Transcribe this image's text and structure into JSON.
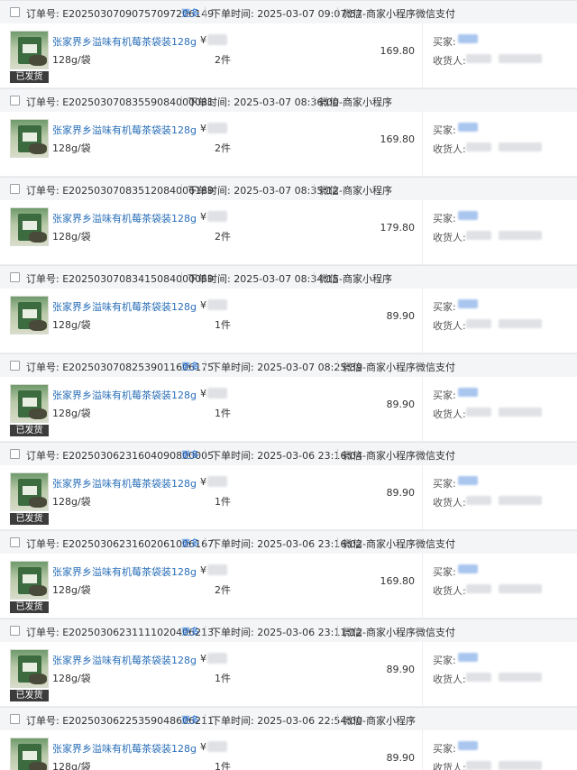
{
  "labels": {
    "order_no": "订单号:",
    "order_time": "下单时间:",
    "buyer": "买家:",
    "receiver": "收货人:",
    "more": "更多",
    "shipped": "已发货",
    "price_symbol": "¥"
  },
  "product": {
    "name": "张家界乡溢味有机莓茶袋装128g",
    "spec": "128g/袋"
  },
  "orders": [
    {
      "id": "E20250307090757097206149",
      "time": "2025-03-07 09:07:57",
      "channel": "微信-商家小程序",
      "payment": "微信支付",
      "has_more": true,
      "shipped": true,
      "qty": "2件",
      "total": "169.80"
    },
    {
      "id": "E20250307083559084000031",
      "time": "2025-03-07 08:36:00",
      "channel": "微信-商家小程序",
      "payment": "",
      "has_more": false,
      "shipped": false,
      "qty": "2件",
      "total": "169.80"
    },
    {
      "id": "E20250307083512084006189",
      "time": "2025-03-07 08:35:12",
      "channel": "微信-商家小程序",
      "payment": "",
      "has_more": false,
      "shipped": false,
      "qty": "2件",
      "total": "179.80"
    },
    {
      "id": "E20250307083415084000059",
      "time": "2025-03-07 08:34:15",
      "channel": "微信-商家小程序",
      "payment": "",
      "has_more": false,
      "shipped": false,
      "qty": "1件",
      "total": "89.90"
    },
    {
      "id": "E20250307082539011606175",
      "time": "2025-03-07 08:25:39",
      "channel": "微信-商家小程序",
      "payment": "微信支付",
      "has_more": true,
      "shipped": true,
      "qty": "1件",
      "total": "89.90"
    },
    {
      "id": "E20250306231604090800005",
      "time": "2025-03-06 23:16:04",
      "channel": "微信-商家小程序",
      "payment": "微信支付",
      "has_more": true,
      "shipped": true,
      "qty": "1件",
      "total": "89.90"
    },
    {
      "id": "E20250306231602061006167",
      "time": "2025-03-06 23:16:02",
      "channel": "微信-商家小程序",
      "payment": "微信支付",
      "has_more": true,
      "shipped": true,
      "qty": "2件",
      "total": "169.80"
    },
    {
      "id": "E20250306231111020406213",
      "time": "2025-03-06 23:11:12",
      "channel": "微信-商家小程序",
      "payment": "微信支付",
      "has_more": true,
      "shipped": true,
      "qty": "1件",
      "total": "89.90"
    },
    {
      "id": "E20250306225359048606211",
      "time": "2025-03-06 22:54:00",
      "channel": "微信-商家小程序",
      "payment": "",
      "has_more": true,
      "shipped": true,
      "qty": "1件",
      "total": "89.90"
    }
  ],
  "colors": {
    "link": "#2a6fb8",
    "more": "#1e6fd9",
    "header_bg": "#f4f5f7",
    "shipped_bg": "#3c3c3c"
  },
  "icons": {
    "checkbox": "checkbox-icon",
    "product_thumbnail": "product-thumbnail-icon"
  }
}
